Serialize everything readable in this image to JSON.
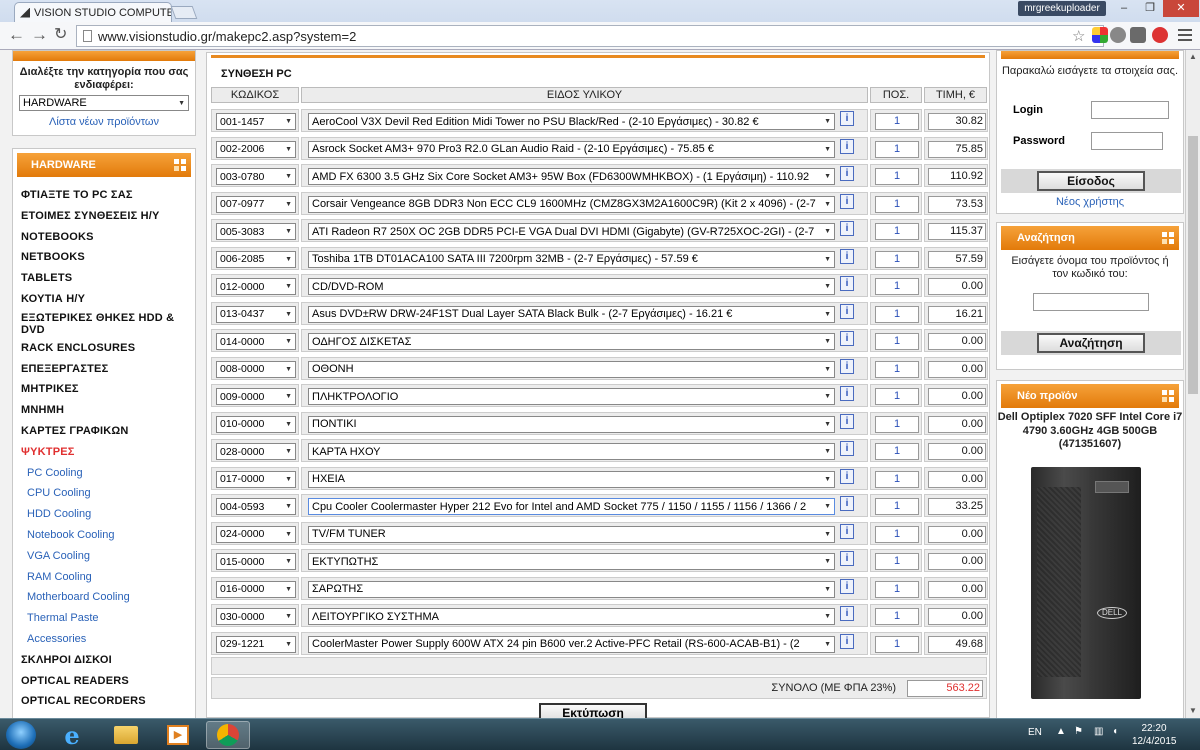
{
  "browser": {
    "tab_title": "VISION STUDIO COMPUTE",
    "profile": "mrgreekuploader",
    "url": "www.visionstudio.gr/makepc2.asp?system=2"
  },
  "left": {
    "category_label": "Διαλέξτε την κατηγορία που σας ενδιαφέρει:",
    "category_value": "HARDWARE",
    "new_products_link": "Λίστα νέων προϊόντων",
    "menu_title": "HARDWARE",
    "menu": [
      {
        "label": "ΦΤΙΑΞΤΕ ΤΟ PC ΣΑΣ",
        "type": "main"
      },
      {
        "label": "ΕΤΟΙΜΕΣ ΣΥΝΘΕΣΕΙΣ Η/Υ",
        "type": "main"
      },
      {
        "label": "NOTEBOOKS",
        "type": "main"
      },
      {
        "label": "NETBOOKS",
        "type": "main"
      },
      {
        "label": "TABLETS",
        "type": "main"
      },
      {
        "label": "ΚΟΥΤΙΑ Η/Υ",
        "type": "main"
      },
      {
        "label": "ΕΞΩΤΕΡΙΚΕΣ ΘΗΚΕΣ HDD & DVD",
        "type": "two"
      },
      {
        "label": "RACK ENCLOSURES",
        "type": "main"
      },
      {
        "label": "ΕΠΕΞΕΡΓΑΣΤΕΣ",
        "type": "main"
      },
      {
        "label": "ΜΗΤΡΙΚΕΣ",
        "type": "main"
      },
      {
        "label": "ΜΝΗΜΗ",
        "type": "main"
      },
      {
        "label": "ΚΑΡΤΕΣ ΓΡΑΦΙΚΩΝ",
        "type": "main"
      },
      {
        "label": "ΨΥΚΤΡΕΣ",
        "type": "red"
      },
      {
        "label": "PC Cooling",
        "type": "sub"
      },
      {
        "label": "CPU Cooling",
        "type": "sub"
      },
      {
        "label": "HDD Cooling",
        "type": "sub"
      },
      {
        "label": "Notebook Cooling",
        "type": "sub"
      },
      {
        "label": "VGA Cooling",
        "type": "sub"
      },
      {
        "label": "RAM Cooling",
        "type": "sub"
      },
      {
        "label": "Motherboard Cooling",
        "type": "sub"
      },
      {
        "label": "Thermal Paste",
        "type": "sub"
      },
      {
        "label": "Accessories",
        "type": "sub"
      },
      {
        "label": "ΣΚΛΗΡΟΙ ΔΙΣΚΟΙ",
        "type": "main"
      },
      {
        "label": "OPTICAL READERS",
        "type": "main"
      },
      {
        "label": "OPTICAL RECORDERS",
        "type": "main"
      }
    ]
  },
  "builder": {
    "title": "ΣΥΝΘΕΣΗ PC",
    "headers": {
      "code": "ΚΩΔΙΚΟΣ",
      "item": "ΕΙΔΟΣ ΥΛΙΚΟΥ",
      "qty": "ΠΟΣ.",
      "price": "ΤΙΜΗ, €"
    },
    "info_label": "i",
    "rows": [
      {
        "code": "001-1457",
        "product": "AeroCool V3X Devil Red Edition Midi Tower no PSU Black/Red - (2-10 Εργάσιμες) - 30.82 €",
        "qty": "1",
        "price": "30.82"
      },
      {
        "code": "002-2006",
        "product": "Asrock Socket AM3+ 970 Pro3 R2.0 GLan Audio Raid - (2-10 Εργάσιμες) - 75.85 €",
        "qty": "1",
        "price": "75.85"
      },
      {
        "code": "003-0780",
        "product": "AMD FX 6300 3.5 GHz Six Core Socket AM3+ 95W Box (FD6300WMHKBOX) - (1 Εργάσιμη) - 110.92",
        "qty": "1",
        "price": "110.92"
      },
      {
        "code": "007-0977",
        "product": "Corsair Vengeance 8GB DDR3 Non ECC CL9 1600MHz (CMZ8GX3M2A1600C9R) (Kit 2 x 4096) - (2-7",
        "qty": "1",
        "price": "73.53"
      },
      {
        "code": "005-3083",
        "product": "ATI Radeon R7 250X OC 2GB DDR5 PCI-E VGA Dual DVI HDMI (Gigabyte) (GV-R725XOC-2GI) - (2-7",
        "qty": "1",
        "price": "115.37"
      },
      {
        "code": "006-2085",
        "product": "Toshiba 1TB DT01ACA100 SATA III 7200rpm 32MB - (2-7 Εργάσιμες) - 57.59 €",
        "qty": "1",
        "price": "57.59"
      },
      {
        "code": "012-0000",
        "product": "CD/DVD-ROM",
        "qty": "1",
        "price": "0.00"
      },
      {
        "code": "013-0437",
        "product": "Asus DVD±RW DRW-24F1ST Dual Layer SATA Black Bulk - (2-7 Εργάσιμες) - 16.21 €",
        "qty": "1",
        "price": "16.21"
      },
      {
        "code": "014-0000",
        "product": "ΟΔΗΓΟΣ ΔΙΣΚΕΤΑΣ",
        "qty": "1",
        "price": "0.00"
      },
      {
        "code": "008-0000",
        "product": "ΟΘΟΝΗ",
        "qty": "1",
        "price": "0.00"
      },
      {
        "code": "009-0000",
        "product": "ΠΛΗΚΤΡΟΛΟΓΙΟ",
        "qty": "1",
        "price": "0.00"
      },
      {
        "code": "010-0000",
        "product": "ΠΟΝΤΙΚΙ",
        "qty": "1",
        "price": "0.00"
      },
      {
        "code": "028-0000",
        "product": "ΚΑΡΤΑ ΗΧΟΥ",
        "qty": "1",
        "price": "0.00"
      },
      {
        "code": "017-0000",
        "product": "ΗΧΕΙΑ",
        "qty": "1",
        "price": "0.00"
      },
      {
        "code": "004-0593",
        "product": "Cpu Cooler Coolermaster Hyper 212 Evo for Intel and AMD Socket 775 / 1150 / 1155 / 1156 / 1366 / 2",
        "qty": "1",
        "price": "33.25"
      },
      {
        "code": "024-0000",
        "product": "TV/FM TUNER",
        "qty": "1",
        "price": "0.00"
      },
      {
        "code": "015-0000",
        "product": "ΕΚΤΥΠΩΤΗΣ",
        "qty": "1",
        "price": "0.00"
      },
      {
        "code": "016-0000",
        "product": "ΣΑΡΩΤΗΣ",
        "qty": "1",
        "price": "0.00"
      },
      {
        "code": "030-0000",
        "product": "ΛΕΙΤΟΥΡΓΙΚΟ ΣΥΣΤΗΜΑ",
        "qty": "1",
        "price": "0.00"
      },
      {
        "code": "029-1221",
        "product": "CoolerMaster Power Supply 600W ATX 24 pin B600 ver.2 Active-PFC Retail (RS-600-ACAB-B1) - (2",
        "qty": "1",
        "price": "49.68"
      }
    ],
    "total_label": "ΣΥΝΟΛΟ (ΜΕ ΦΠΑ 23%)",
    "total_value": "563.22",
    "print_button": "Εκτύπωση"
  },
  "right": {
    "login_prompt": "Παρακαλώ εισάγετε τα στοιχεία σας.",
    "login_label": "Login",
    "password_label": "Password",
    "login_button": "Είσοδος",
    "new_user_link": "Νέος χρήστης",
    "search_title": "Αναζήτηση",
    "search_prompt": "Εισάγετε όνομα του προϊόντος ή τον κωδικό του:",
    "search_button": "Αναζήτηση",
    "new_product_title": "Νέο προϊόν",
    "new_product_name": "Dell Optiplex 7020 SFF Intel Core i7 4790 3.60GHz 4GB 500GB (471351607)",
    "dell_logo": "DELL"
  },
  "taskbar": {
    "lang": "EN",
    "time": "22:20",
    "date": "12/4/2015"
  }
}
